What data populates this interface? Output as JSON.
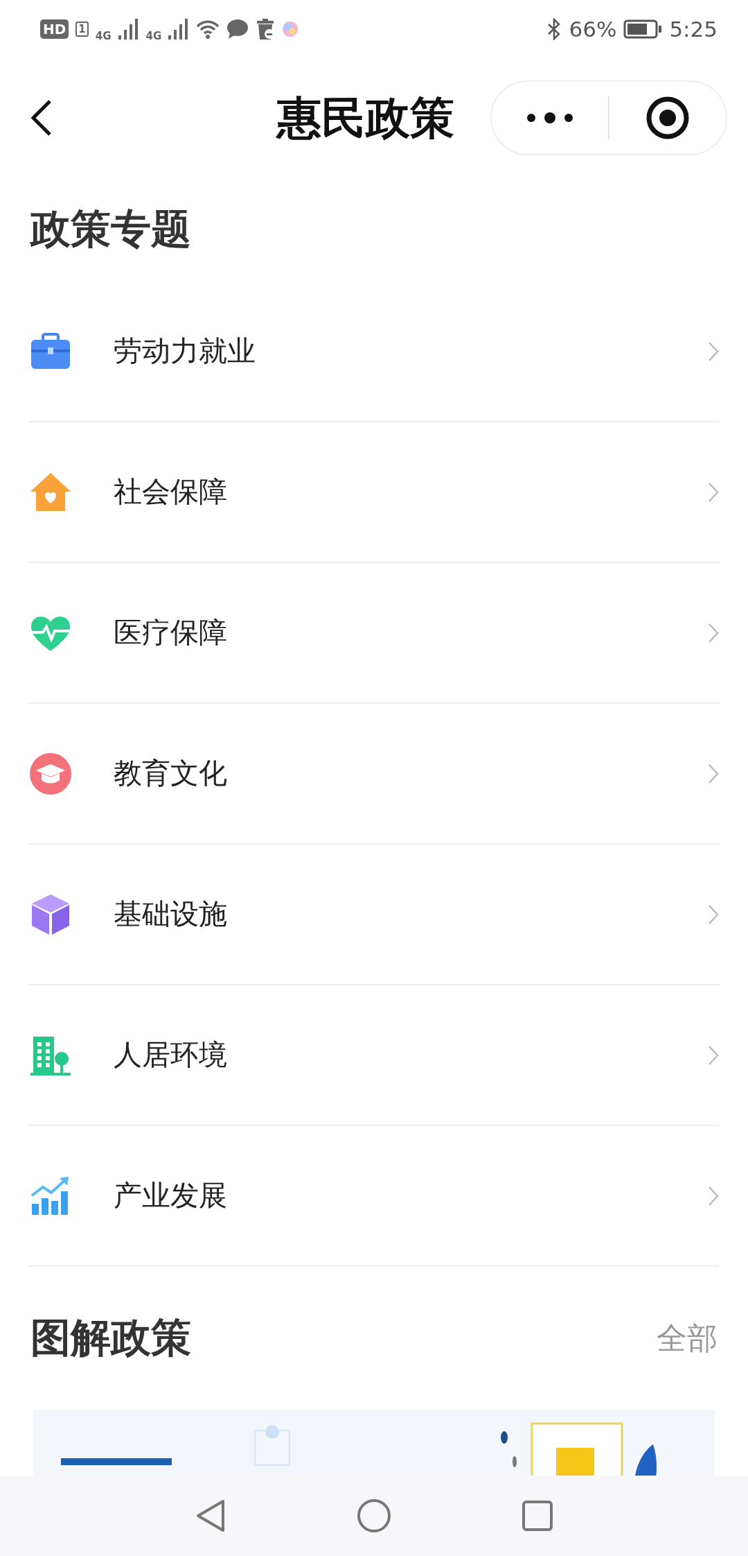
{
  "status_bar": {
    "hd": "HD",
    "sim": "1",
    "network_1": "4G",
    "network_2": "4G",
    "battery": "66%",
    "time": "5:25"
  },
  "nav_bar": {
    "title": "惠民政策"
  },
  "topics": {
    "title": "政策专题",
    "items": [
      {
        "kind": "briefcase",
        "label": "劳动力就业"
      },
      {
        "kind": "house",
        "label": "社会保障"
      },
      {
        "kind": "heart",
        "label": "医疗保障"
      },
      {
        "kind": "cap",
        "label": "教育文化"
      },
      {
        "kind": "cube",
        "label": "基础设施"
      },
      {
        "kind": "building",
        "label": "人居环境"
      },
      {
        "kind": "chart",
        "label": "产业发展"
      }
    ]
  },
  "illustrated": {
    "title": "图解政策",
    "more": "全部"
  }
}
